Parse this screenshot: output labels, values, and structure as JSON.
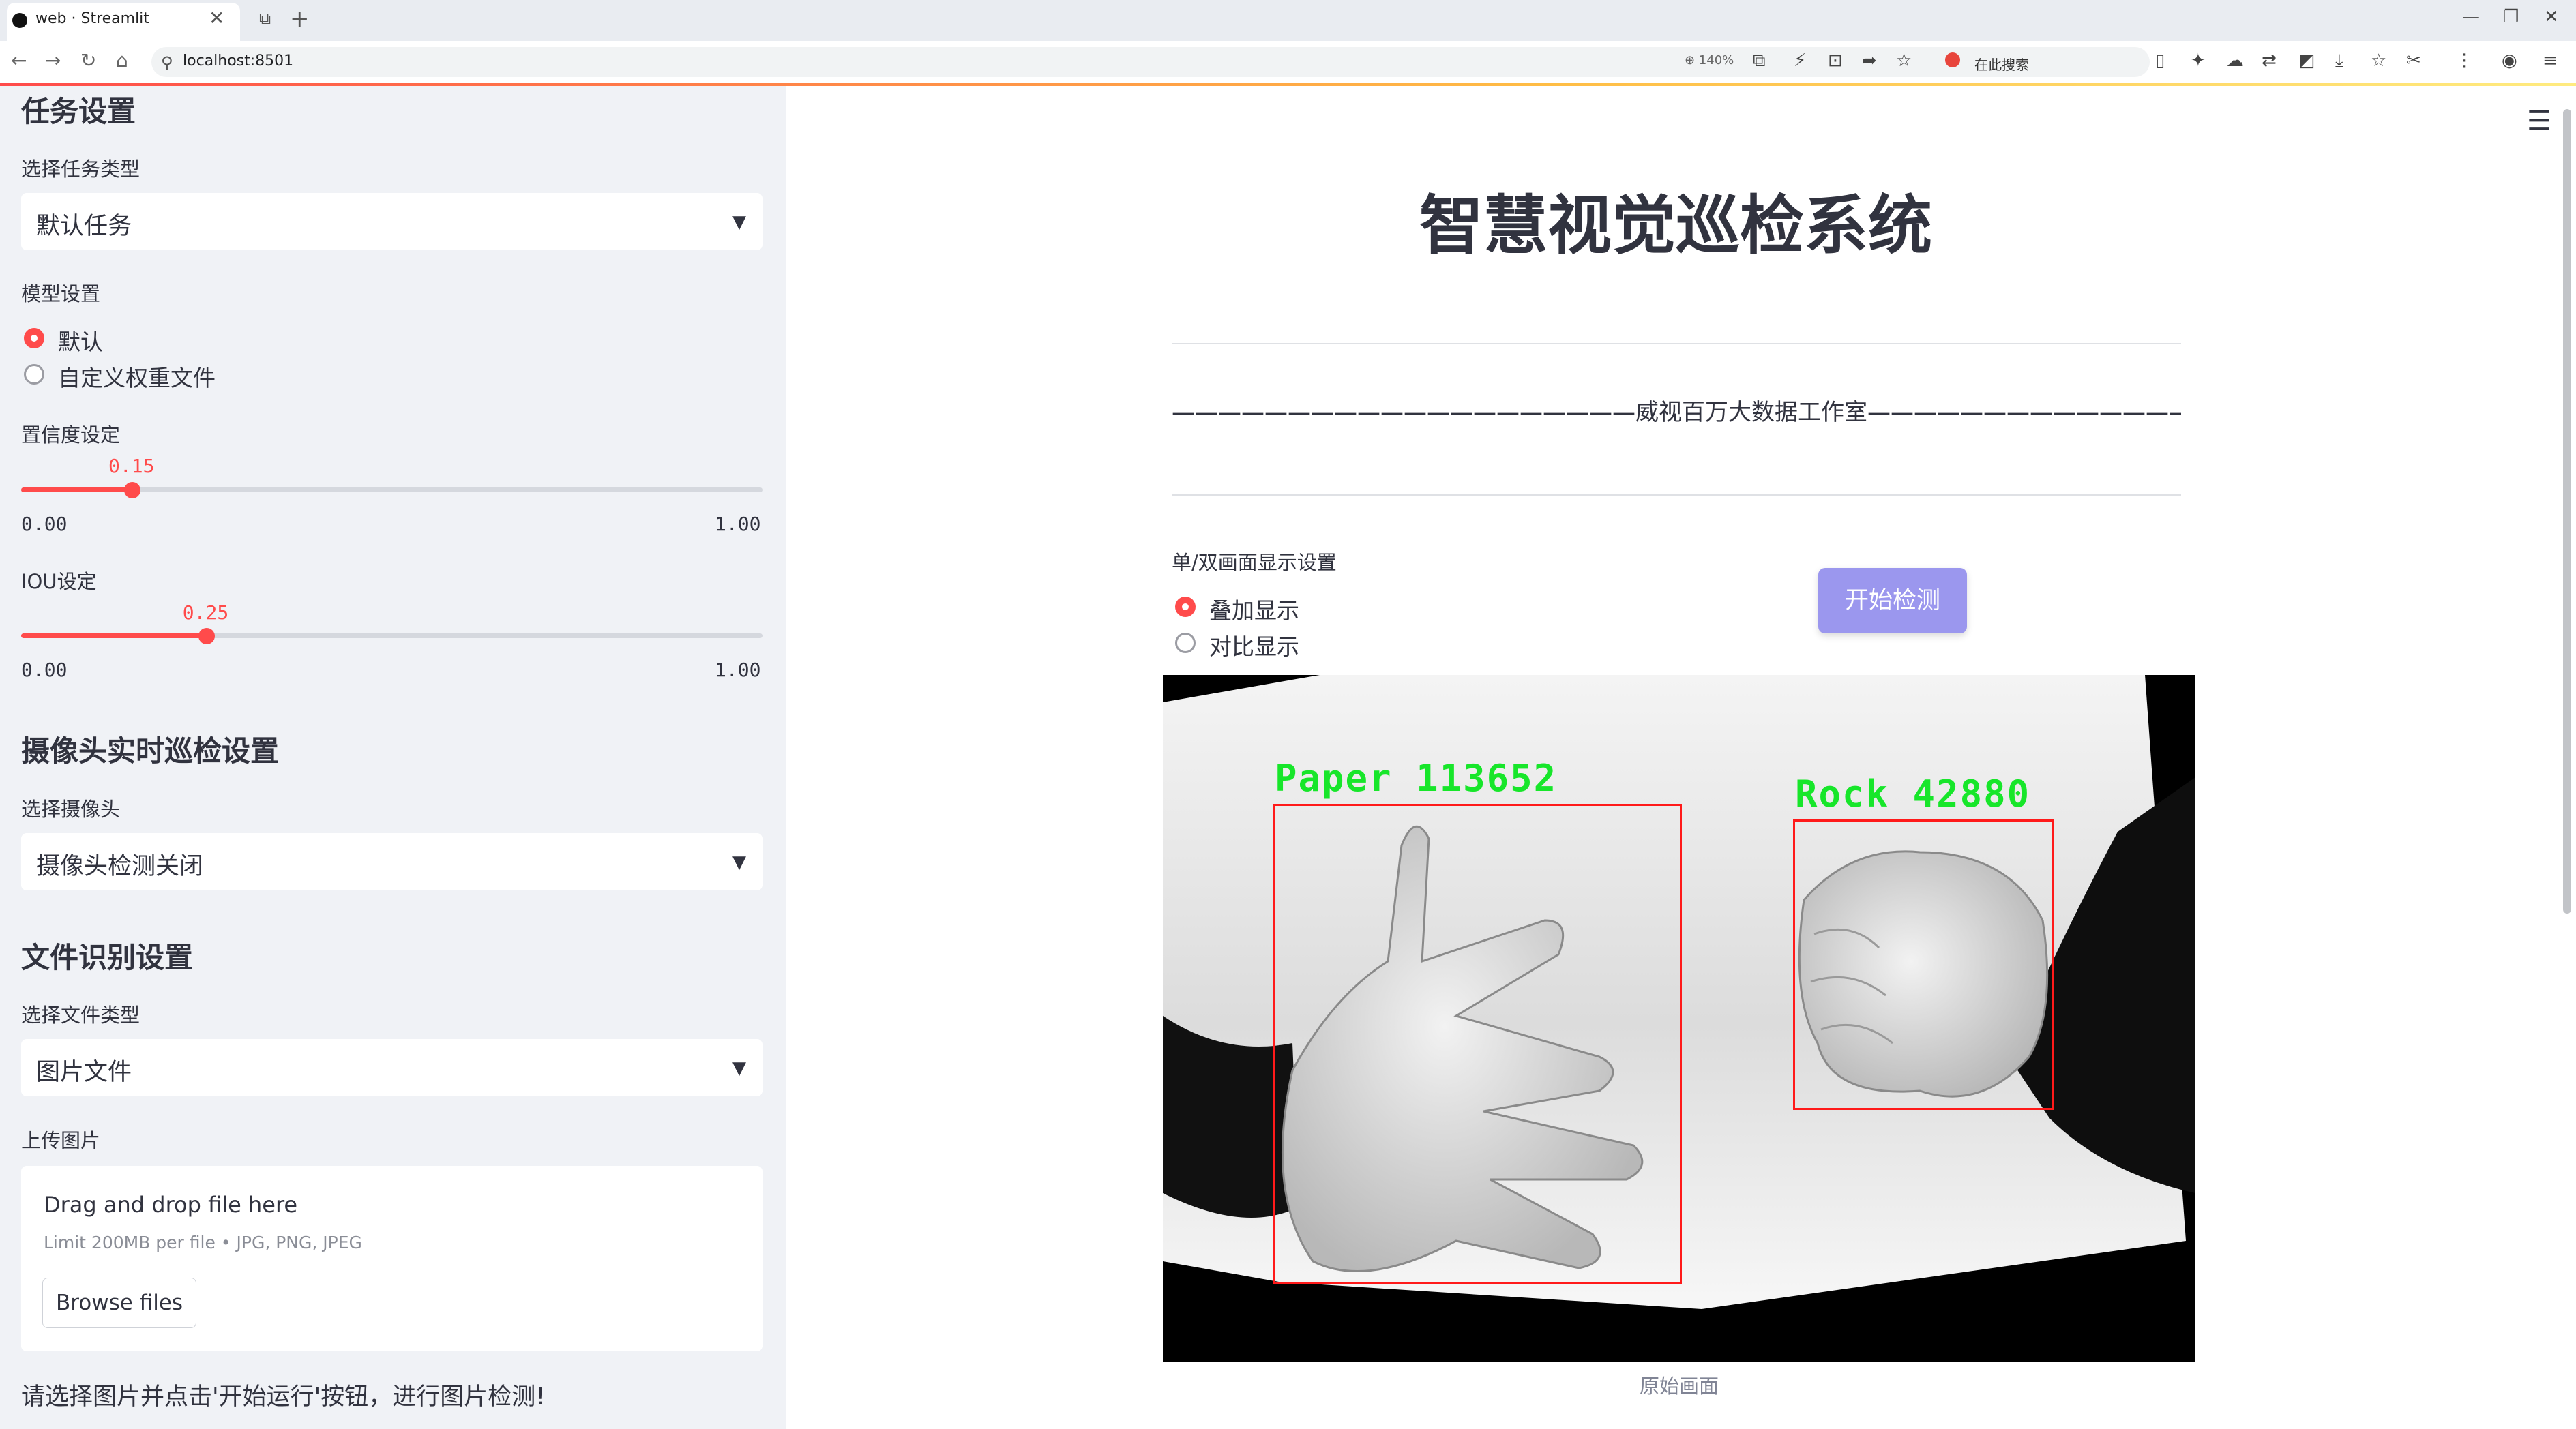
{
  "browser": {
    "tab_title": "web · Streamlit",
    "url": "localhost:8501",
    "zoom": "140%",
    "search_placeholder": "在此搜索"
  },
  "sidebar": {
    "task_section_title": "任务设置",
    "task_type_label": "选择任务类型",
    "task_type_value": "默认任务",
    "model_label": "模型设置",
    "model_options": [
      "默认",
      "自定义权重文件"
    ],
    "model_selected": "默认",
    "conf": {
      "label": "置信度设定",
      "value": "0.15",
      "min": "0.00",
      "max": "1.00",
      "fraction": 0.15
    },
    "iou": {
      "label": "IOU设定",
      "value": "0.25",
      "min": "0.00",
      "max": "1.00",
      "fraction": 0.25
    },
    "camera_section_title": "摄像头实时巡检设置",
    "camera_label": "选择摄像头",
    "camera_value": "摄像头检测关闭",
    "file_section_title": "文件识别设置",
    "file_type_label": "选择文件类型",
    "file_type_value": "图片文件",
    "upload_label": "上传图片",
    "upload": {
      "drop_title": "Drag and drop file here",
      "limit": "Limit 200MB per file • JPG, PNG, JPEG",
      "browse": "Browse files"
    },
    "note": "请选择图片并点击'开始运行'按钮，进行图片检测!"
  },
  "main": {
    "title": "智慧视觉巡检系统",
    "subtitle": "————————————————————威视百万大数据工作室—————————————————————",
    "display_label": "单/双画面显示设置",
    "display_options": [
      "叠加显示",
      "对比显示"
    ],
    "display_selected": "叠加显示",
    "start_button": "开始检测",
    "caption": "原始画面",
    "detections": [
      {
        "label": "Paper 113652"
      },
      {
        "label": "Rock 42880"
      }
    ]
  },
  "colors": {
    "accent": "#ff4b4b",
    "start_button": "#9b97ee",
    "detection_box": "#ff1a1a",
    "detection_text": "#17e62a"
  }
}
